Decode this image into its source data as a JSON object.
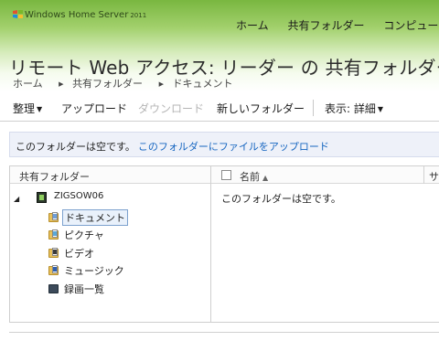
{
  "brand": {
    "name": "Windows Home Server",
    "year": "2011"
  },
  "top_nav": [
    "ホーム",
    "共有フォルダー",
    "コンピュータ"
  ],
  "page_title": "リモート Web アクセス: リーダー の 共有フォルダー",
  "breadcrumb": [
    "ホーム",
    "共有フォルダー",
    "ドキュメント"
  ],
  "toolbar": {
    "organize": "整理",
    "upload": "アップロード",
    "download": "ダウンロード",
    "new_folder": "新しいフォルダー",
    "view": "表示: 詳細"
  },
  "info_bar": {
    "message": "このフォルダーは空です。",
    "link": "このフォルダーにファイルをアップロード"
  },
  "left_pane": {
    "header": "共有フォルダー",
    "computer": "ZIGSOW06",
    "folders": [
      {
        "label": "ドキュメント",
        "selected": true
      },
      {
        "label": "ピクチャ"
      },
      {
        "label": "ビデオ"
      },
      {
        "label": "ミュージック"
      },
      {
        "label": "録画一覧"
      }
    ]
  },
  "right_pane": {
    "name_header": "名前",
    "second_header": "サ",
    "empty_message": "このフォルダーは空です。"
  },
  "colors": {
    "header_green": "#79b740",
    "link_blue": "#1565c0",
    "info_bg": "#eef1f9"
  }
}
